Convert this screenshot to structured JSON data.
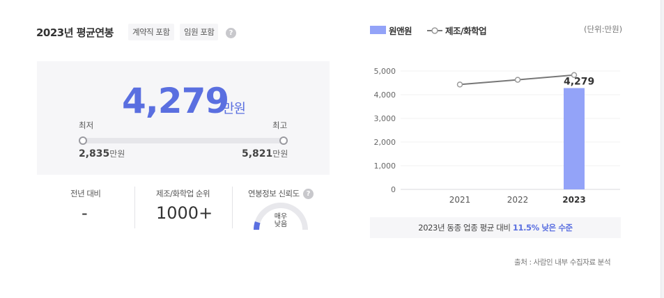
{
  "header": {
    "title": "2023년 평균연봉",
    "tags": [
      "계약직 포함",
      "임원 포함"
    ],
    "help_glyph": "?"
  },
  "salary": {
    "average": "4,279",
    "unit": "만원",
    "min_label": "최저",
    "max_label": "최고",
    "min_value": "2,835",
    "max_value": "5,821",
    "value_unit": "만원"
  },
  "stats": {
    "yoy_label": "전년 대비",
    "yoy_value": "-",
    "rank_label": "제조/화학업 순위",
    "rank_value": "1000+",
    "reliability_label": "연봉정보 신뢰도",
    "reliability_line1": "매우",
    "reliability_line2": "낮음",
    "reliability_level": 0.1,
    "reliability_color": "#5a6fe0"
  },
  "legend": {
    "bar_label": "원앤원",
    "line_label": "제조/화학업",
    "unit": "(단위:만원)"
  },
  "chart_data": {
    "type": "bar",
    "categories": [
      "2021",
      "2022",
      "2023"
    ],
    "highlight_category": "2023",
    "ylim": [
      0,
      5000
    ],
    "yticks": [
      "0",
      "1,000",
      "2,000",
      "3,000",
      "4,000",
      "5,000"
    ],
    "series": [
      {
        "name": "원앤원",
        "type": "bar",
        "values": [
          null,
          null,
          4279
        ],
        "color": "#93a3f8"
      },
      {
        "name": "제조/화학업",
        "type": "line",
        "values": [
          4430,
          4630,
          4830
        ],
        "color": "#777777"
      }
    ],
    "data_label": "4,279"
  },
  "summary": {
    "prefix": "2023년 동종 업종 평균 대비",
    "highlight": "11.5% 낮은 수준"
  },
  "source": "출처 : 사람인 내부 수집자료 분석",
  "colors": {
    "accent": "#5a6fe0",
    "bar": "#93a3f8",
    "line": "#777777"
  }
}
